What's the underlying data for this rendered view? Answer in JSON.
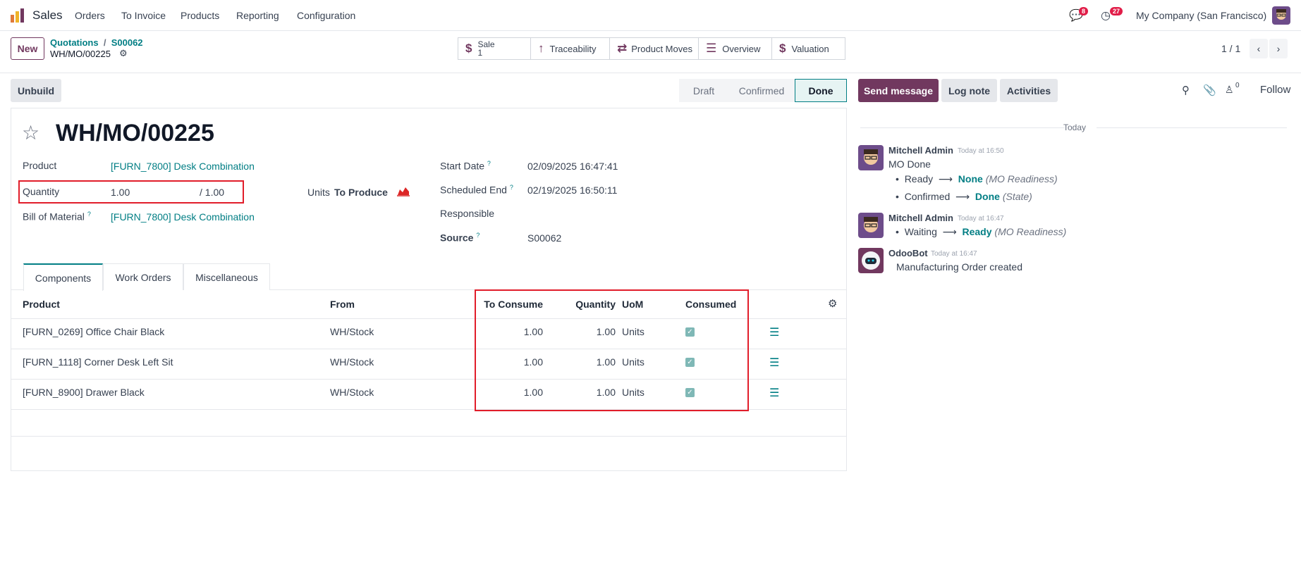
{
  "navbar": {
    "app_name": "Sales",
    "menu": [
      "Orders",
      "To Invoice",
      "Products",
      "Reporting",
      "Configuration"
    ],
    "messages_count": "8",
    "activities_count": "27",
    "company": "My Company (San Francisco)"
  },
  "control_panel": {
    "new_label": "New",
    "breadcrumb": [
      "Quotations",
      "S00062"
    ],
    "record_name": "WH/MO/00225",
    "pager": "1 / 1",
    "smart_buttons": {
      "sale_label": "Sale",
      "sale_count": "1",
      "traceability": "Traceability",
      "product_moves": "Product Moves",
      "overview": "Overview",
      "valuation": "Valuation"
    }
  },
  "actions": {
    "unbuild": "Unbuild",
    "statuses": [
      "Draft",
      "Confirmed",
      "Done"
    ],
    "active_status": "Done"
  },
  "form": {
    "title": "WH/MO/00225",
    "product_label": "Product",
    "product_value": "[FURN_7800] Desk Combination",
    "quantity_label": "Quantity",
    "quantity_value": "1.00",
    "quantity_target": "/ 1.00",
    "units_label": "Units",
    "to_produce": "To Produce",
    "bom_label": "Bill of Material",
    "help_mark": "?",
    "bom_value": "[FURN_7800] Desk Combination",
    "start_date_label": "Start Date",
    "start_date_value": "02/09/2025 16:47:41",
    "scheduled_end_label": "Scheduled End",
    "scheduled_end_value": "02/19/2025 16:50:11",
    "responsible_label": "Responsible",
    "source_label": "Source",
    "source_value": "S00062"
  },
  "tabs": [
    "Components",
    "Work Orders",
    "Miscellaneous"
  ],
  "table": {
    "headers": [
      "Product",
      "From",
      "To Consume",
      "Quantity",
      "UoM",
      "Consumed"
    ],
    "rows": [
      {
        "product": "[FURN_0269] Office Chair Black",
        "from": "WH/Stock",
        "to_consume": "1.00",
        "quantity": "1.00",
        "uom": "Units",
        "consumed": true
      },
      {
        "product": "[FURN_1118] Corner Desk Left Sit",
        "from": "WH/Stock",
        "to_consume": "1.00",
        "quantity": "1.00",
        "uom": "Units",
        "consumed": true
      },
      {
        "product": "[FURN_8900] Drawer Black",
        "from": "WH/Stock",
        "to_consume": "1.00",
        "quantity": "1.00",
        "uom": "Units",
        "consumed": true
      }
    ]
  },
  "chatter": {
    "send_message": "Send message",
    "log_note": "Log note",
    "activities": "Activities",
    "followers_count": "0",
    "follow": "Follow",
    "date_divider": "Today",
    "messages": [
      {
        "author": "Mitchell Admin",
        "time": "Today at 16:50",
        "body": "MO Done",
        "changes": [
          {
            "old": "Ready",
            "new": "None",
            "field": "(MO Readiness)"
          },
          {
            "old": "Confirmed",
            "new": "Done",
            "field": "(State)"
          }
        ]
      },
      {
        "author": "Mitchell Admin",
        "time": "Today at 16:47",
        "body": "",
        "changes": [
          {
            "old": "Waiting",
            "new": "Ready",
            "field": "(MO Readiness)"
          }
        ]
      },
      {
        "author": "OdooBot",
        "time": "Today at 16:47",
        "body": "Manufacturing Order created",
        "changes": []
      }
    ]
  },
  "colors": {
    "brand": "#71385f",
    "link": "#017e84",
    "highlight": "#e11d2a"
  }
}
